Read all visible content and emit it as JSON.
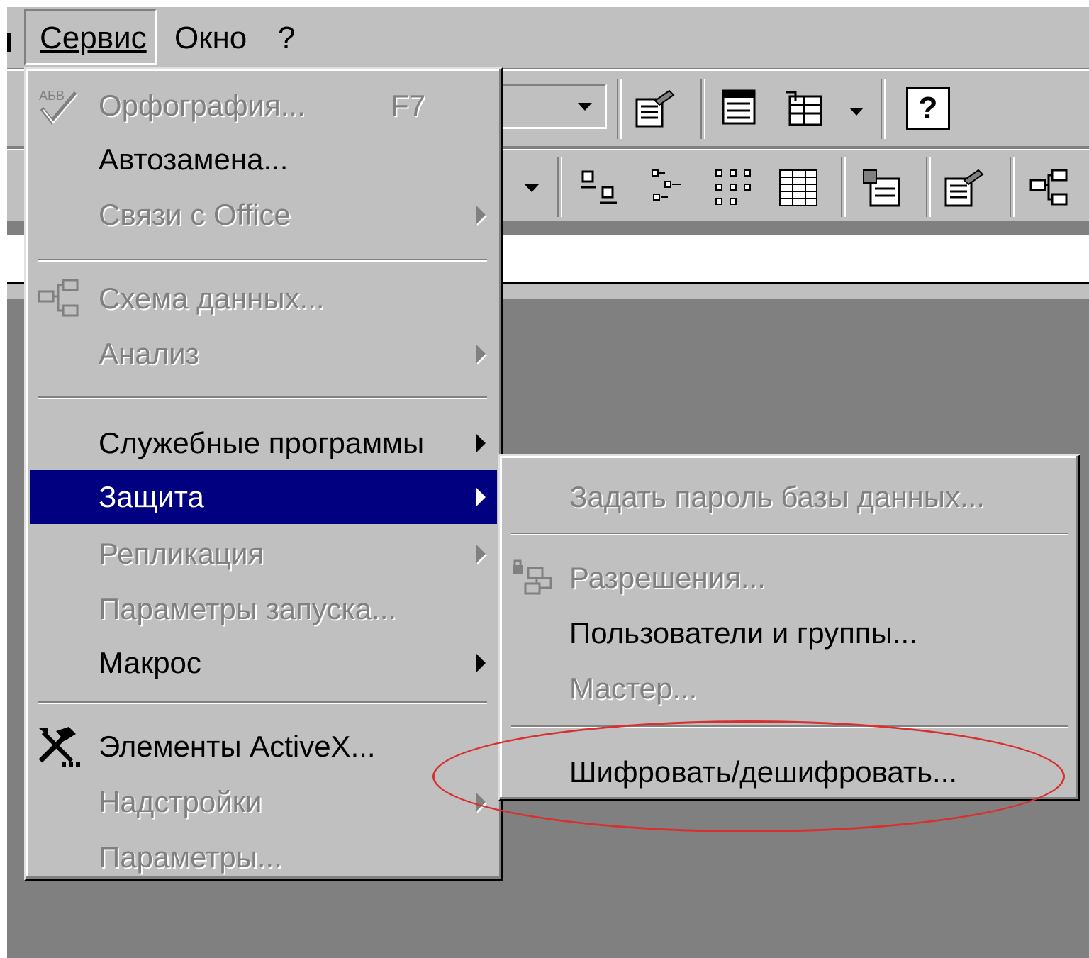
{
  "menubar": {
    "items": [
      {
        "label": "Сервис"
      },
      {
        "label": "Окно"
      },
      {
        "label": "?"
      }
    ]
  },
  "toolbar": {
    "help_label": "?"
  },
  "main_menu": {
    "items": [
      {
        "label": "Орфография...",
        "shortcut": "F7",
        "disabled": true,
        "icon": "spellcheck-icon"
      },
      {
        "label": "Автозамена...",
        "disabled": false
      },
      {
        "label": "Связи с Office",
        "disabled": true,
        "submenu": true
      },
      {
        "label": "Схема данных...",
        "disabled": true,
        "icon": "relationships-icon"
      },
      {
        "label": "Анализ",
        "disabled": true,
        "submenu": true
      },
      {
        "label": "Служебные программы",
        "disabled": false,
        "submenu": true
      },
      {
        "label": "Защита",
        "disabled": false,
        "submenu": true,
        "highlighted": true
      },
      {
        "label": "Репликация",
        "disabled": true,
        "submenu": true
      },
      {
        "label": "Параметры запуска...",
        "disabled": true
      },
      {
        "label": "Макрос",
        "disabled": false,
        "submenu": true
      },
      {
        "label": "Элементы ActiveX...",
        "disabled": false,
        "icon": "tools-icon"
      },
      {
        "label": "Надстройки",
        "disabled": true,
        "submenu": true
      },
      {
        "label": "Параметры...",
        "disabled": true
      }
    ]
  },
  "sub_menu": {
    "items": [
      {
        "label": "Задать пароль базы данных...",
        "disabled": true
      },
      {
        "label": "Разрешения...",
        "disabled": true,
        "icon": "permissions-icon"
      },
      {
        "label": "Пользователи и группы...",
        "disabled": false
      },
      {
        "label": "Мастер...",
        "disabled": true
      },
      {
        "label": "Шифровать/дешифровать...",
        "disabled": false
      }
    ]
  },
  "colors": {
    "highlight": "#000080",
    "menu_face": "#c0c0c0",
    "annotation": "#d83030"
  }
}
